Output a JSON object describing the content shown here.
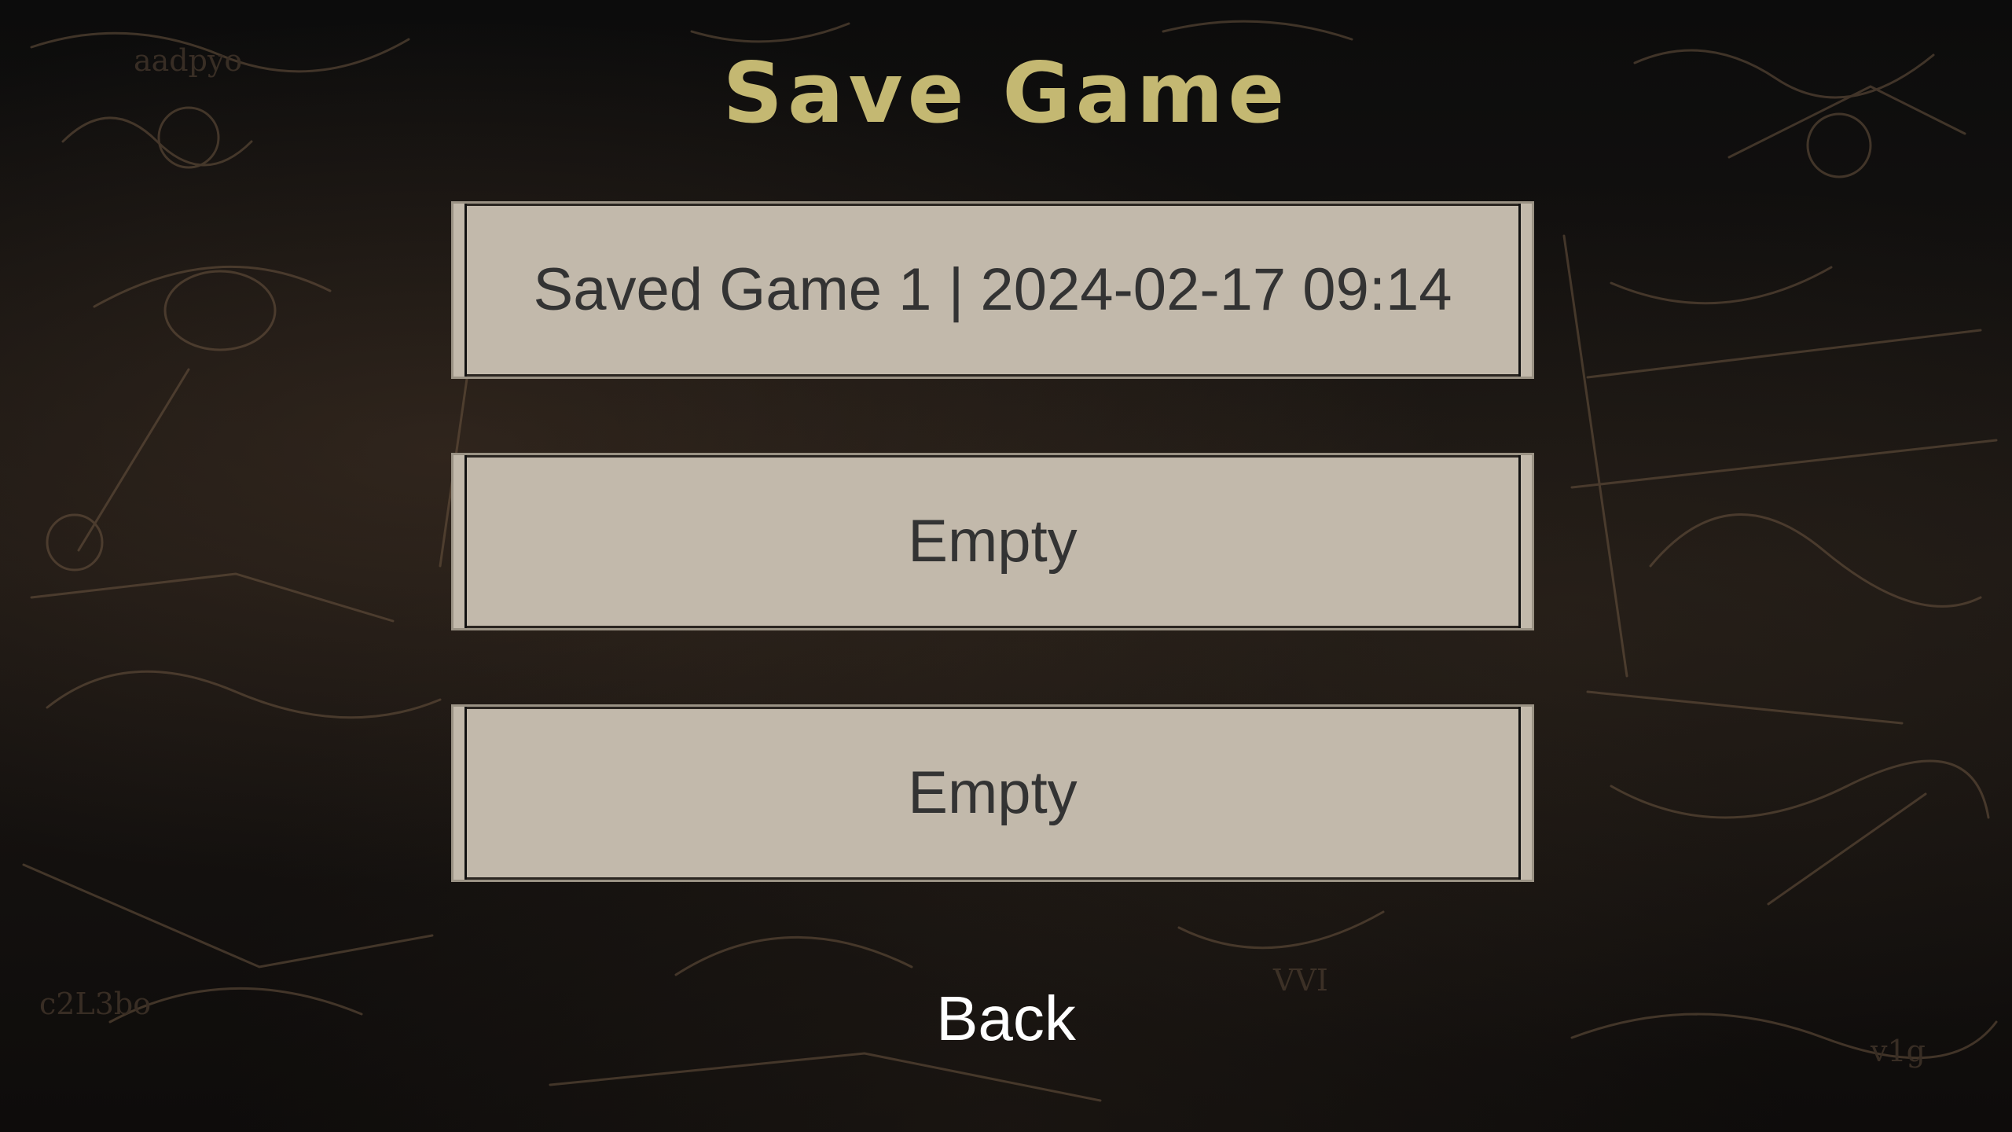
{
  "screen": {
    "title": "Save Game",
    "back_label": "Back"
  },
  "slots": [
    {
      "label": "Saved Game 1 | 2024-02-17 09:14"
    },
    {
      "label": "Empty"
    },
    {
      "label": "Empty"
    }
  ],
  "colors": {
    "title": "#c4b872",
    "slot_bg": "#c2b9ab",
    "slot_text": "#333333",
    "back": "#ffffff"
  }
}
